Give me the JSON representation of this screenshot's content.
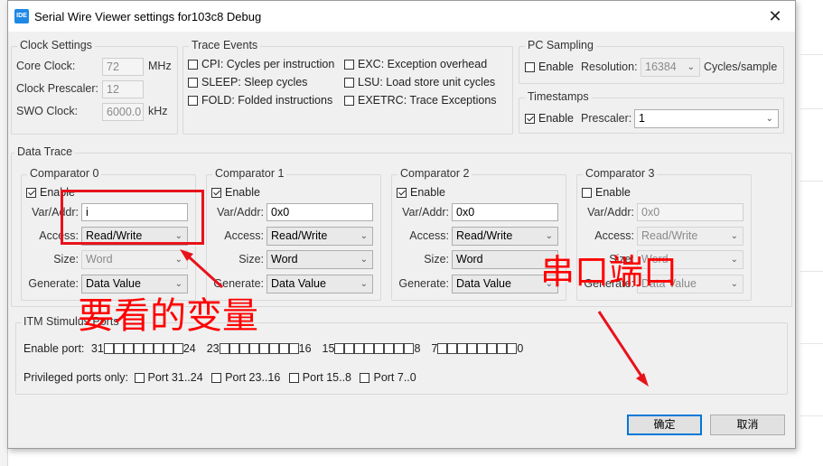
{
  "window": {
    "title": "Serial Wire Viewer settings for103c8 Debug",
    "icon": "IDE"
  },
  "clock": {
    "title": "Clock Settings",
    "core_label": "Core Clock:",
    "core_value": "72",
    "core_unit": "MHz",
    "prescaler_label": "Clock Prescaler:",
    "prescaler_value": "12",
    "swo_label": "SWO Clock:",
    "swo_value": "6000.0",
    "swo_unit": "kHz"
  },
  "trace": {
    "title": "Trace Events",
    "items": [
      {
        "label": "CPI: Cycles per instruction",
        "checked": false
      },
      {
        "label": "SLEEP: Sleep cycles",
        "checked": false
      },
      {
        "label": "FOLD: Folded instructions",
        "checked": false
      },
      {
        "label": "EXC: Exception overhead",
        "checked": false
      },
      {
        "label": "LSU: Load store unit cycles",
        "checked": false
      },
      {
        "label": "EXETRC: Trace Exceptions",
        "checked": false
      }
    ]
  },
  "pc_sampling": {
    "title": "PC Sampling",
    "enable_label": "Enable",
    "enabled": false,
    "resolution_label": "Resolution:",
    "resolution_value": "16384",
    "unit": "Cycles/sample"
  },
  "timestamps": {
    "title": "Timestamps",
    "enable_label": "Enable",
    "enabled": true,
    "prescaler_label": "Prescaler:",
    "prescaler_value": "1"
  },
  "data_trace": {
    "title": "Data Trace",
    "comparators": [
      {
        "title": "Comparator 0",
        "enable": "Enable",
        "enabled": true,
        "var_label": "Var/Addr:",
        "var_value": "i",
        "access_label": "Access:",
        "access_value": "Read/Write",
        "size_label": "Size:",
        "size_value": "Word",
        "generate_label": "Generate:",
        "generate_value": "Data Value"
      },
      {
        "title": "Comparator 1",
        "enable": "Enable",
        "enabled": true,
        "var_label": "Var/Addr:",
        "var_value": "0x0",
        "access_label": "Access:",
        "access_value": "Read/Write",
        "size_label": "Size:",
        "size_value": "Word",
        "generate_label": "Generate:",
        "generate_value": "Data Value"
      },
      {
        "title": "Comparator 2",
        "enable": "Enable",
        "enabled": true,
        "var_label": "Var/Addr:",
        "var_value": "0x0",
        "access_label": "Access:",
        "access_value": "Read/Write",
        "size_label": "Size:",
        "size_value": "Word",
        "generate_label": "Generate:",
        "generate_value": "Data Value"
      },
      {
        "title": "Comparator 3",
        "enable": "Enable",
        "enabled": false,
        "var_label": "Var/Addr:",
        "var_value": "0x0",
        "access_label": "Access:",
        "access_value": "Read/Write",
        "size_label": "Size:",
        "size_value": "Word",
        "generate_label": "Generate:",
        "generate_value": "Data Value"
      }
    ]
  },
  "itm": {
    "title": "ITM Stimulus Ports",
    "enable_label": "Enable port:",
    "groups": [
      {
        "start": "31",
        "end": "24"
      },
      {
        "start": "23",
        "end": "16"
      },
      {
        "start": "15",
        "end": "8"
      },
      {
        "start": "7",
        "end": "0"
      }
    ],
    "privileged_label": "Privileged ports only:",
    "privileged": [
      "Port 31..24",
      "Port 23..16",
      "Port 15..8",
      "Port 7..0"
    ]
  },
  "buttons": {
    "ok": "确定",
    "cancel": "取消"
  },
  "annotations": {
    "variable_note": "要看的变量",
    "serial_note": "串口端口",
    "color": "#ff0000"
  }
}
